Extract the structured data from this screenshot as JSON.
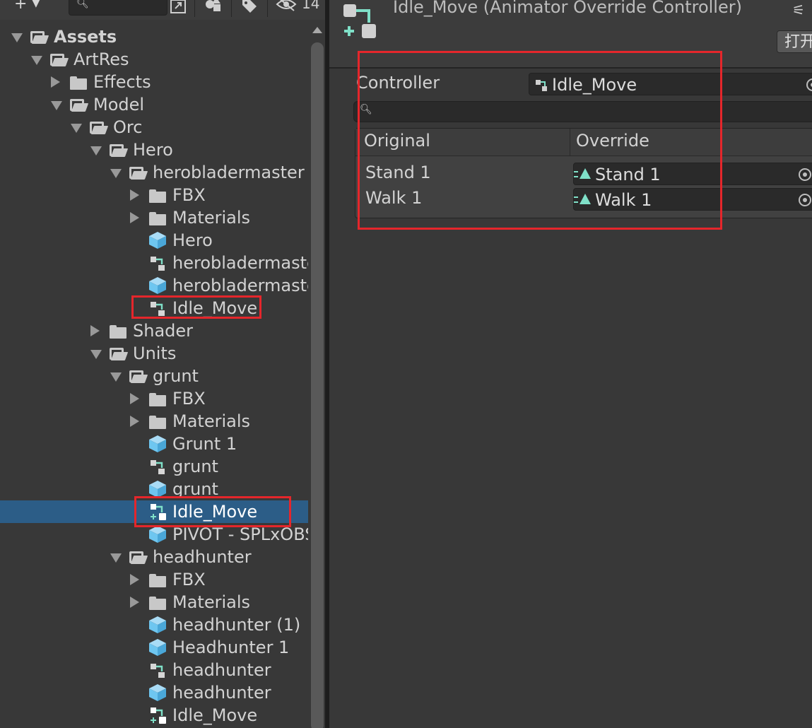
{
  "toolbar": {
    "add_label": "+",
    "search_placeholder": "",
    "hidden_count": "14"
  },
  "tree": [
    {
      "label": "Assets",
      "depth": 0,
      "arrow": "open",
      "icon": "folder-open",
      "bold": true
    },
    {
      "label": "ArtRes",
      "depth": 1,
      "arrow": "open",
      "icon": "folder-open"
    },
    {
      "label": "Effects",
      "depth": 2,
      "arrow": "closed",
      "icon": "folder-closed"
    },
    {
      "label": "Model",
      "depth": 2,
      "arrow": "open",
      "icon": "folder-open"
    },
    {
      "label": "Orc",
      "depth": 3,
      "arrow": "open",
      "icon": "folder-open"
    },
    {
      "label": "Hero",
      "depth": 4,
      "arrow": "open",
      "icon": "folder-open"
    },
    {
      "label": "herobladermaster",
      "depth": 5,
      "arrow": "open",
      "icon": "folder-open"
    },
    {
      "label": "FBX",
      "depth": 6,
      "arrow": "closed",
      "icon": "folder-closed"
    },
    {
      "label": "Materials",
      "depth": 6,
      "arrow": "closed",
      "icon": "folder-closed"
    },
    {
      "label": "Hero",
      "depth": 6,
      "arrow": "none",
      "icon": "prefab"
    },
    {
      "label": "herobladermaster",
      "depth": 6,
      "arrow": "none",
      "icon": "animator-controller"
    },
    {
      "label": "herobladermaster",
      "depth": 6,
      "arrow": "none",
      "icon": "prefab"
    },
    {
      "label": "Idle_Move",
      "depth": 6,
      "arrow": "none",
      "icon": "animator-controller"
    },
    {
      "label": "Shader",
      "depth": 4,
      "arrow": "closed",
      "icon": "folder-closed"
    },
    {
      "label": "Units",
      "depth": 4,
      "arrow": "open",
      "icon": "folder-open"
    },
    {
      "label": "grunt",
      "depth": 5,
      "arrow": "open",
      "icon": "folder-open"
    },
    {
      "label": "FBX",
      "depth": 6,
      "arrow": "closed",
      "icon": "folder-closed"
    },
    {
      "label": "Materials",
      "depth": 6,
      "arrow": "closed",
      "icon": "folder-closed"
    },
    {
      "label": "Grunt 1",
      "depth": 6,
      "arrow": "none",
      "icon": "prefab"
    },
    {
      "label": "grunt",
      "depth": 6,
      "arrow": "none",
      "icon": "animator-controller"
    },
    {
      "label": "grunt",
      "depth": 6,
      "arrow": "none",
      "icon": "prefab"
    },
    {
      "label": "Idle_Move",
      "depth": 6,
      "arrow": "none",
      "icon": "override-controller",
      "selected": true
    },
    {
      "label": "PIVOT - SPLxOBS",
      "depth": 6,
      "arrow": "none",
      "icon": "prefab"
    },
    {
      "label": "headhunter",
      "depth": 5,
      "arrow": "open",
      "icon": "folder-open"
    },
    {
      "label": "FBX",
      "depth": 6,
      "arrow": "closed",
      "icon": "folder-closed"
    },
    {
      "label": "Materials",
      "depth": 6,
      "arrow": "closed",
      "icon": "folder-closed"
    },
    {
      "label": "headhunter (1)",
      "depth": 6,
      "arrow": "none",
      "icon": "prefab"
    },
    {
      "label": "Headhunter 1",
      "depth": 6,
      "arrow": "none",
      "icon": "prefab"
    },
    {
      "label": "headhunter",
      "depth": 6,
      "arrow": "none",
      "icon": "animator-controller"
    },
    {
      "label": "headhunter",
      "depth": 6,
      "arrow": "none",
      "icon": "prefab"
    },
    {
      "label": "Idle_Move",
      "depth": 6,
      "arrow": "none",
      "icon": "override-controller"
    }
  ],
  "inspector": {
    "title": "Idle_Move (Animator Override Controller)",
    "open_label": "打开",
    "controller_label": "Controller",
    "controller_value": "Idle_Move",
    "filter_placeholder": "",
    "columns": {
      "original": "Original",
      "override": "Override"
    },
    "rows": [
      {
        "original": "Stand 1",
        "override": "Stand 1"
      },
      {
        "original": "Walk 1",
        "override": "Walk 1"
      }
    ]
  },
  "colors": {
    "highlight": "#e5262b",
    "selection": "#2c5d87",
    "accent": "#7fe0c8",
    "prefab": "#6ec6f0"
  }
}
